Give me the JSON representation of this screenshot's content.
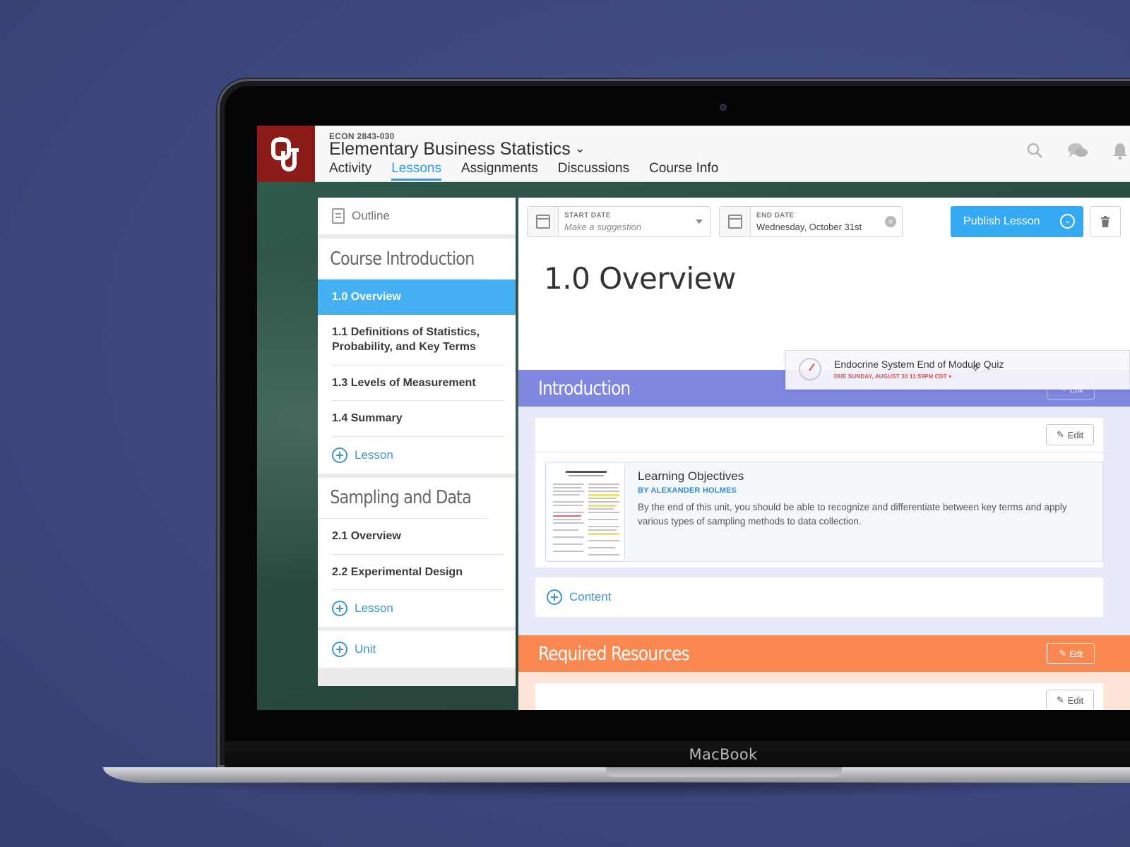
{
  "header": {
    "course_code": "ECON 2843-030",
    "course_title": "Elementary Business Statistics",
    "tabs": [
      {
        "label": "Activity",
        "active": false
      },
      {
        "label": "Lessons",
        "active": true
      },
      {
        "label": "Assignments",
        "active": false
      },
      {
        "label": "Discussions",
        "active": false
      },
      {
        "label": "Course Info",
        "active": false
      }
    ],
    "icons": [
      "search-icon",
      "chat-icon",
      "notification-bell-icon"
    ]
  },
  "sidebar": {
    "outline_label": "Outline",
    "units": [
      {
        "title": "Course Introduction",
        "lessons": [
          "1.0 Overview",
          "1.1 Definitions of Statistics, Probability, and Key Terms",
          "1.3 Levels of Measurement",
          "1.4 Summary"
        ],
        "active_index": 0,
        "add_label": "Lesson"
      },
      {
        "title": "Sampling and Data",
        "lessons": [
          "2.1 Overview",
          "2.2 Experimental Design"
        ],
        "add_label": "Lesson"
      }
    ],
    "add_unit_label": "Unit"
  },
  "main": {
    "start_date": {
      "label": "START DATE",
      "placeholder": "Make a suggestion"
    },
    "end_date": {
      "label": "END DATE",
      "value": "Wednesday, October 31st"
    },
    "publish_label": "Publish Lesson",
    "lesson_title": "1.0 Overview",
    "sections": {
      "introduction": "Introduction",
      "required": "Required Resources"
    },
    "edit_label": "Edit",
    "document": {
      "title": "Learning Objectives",
      "author": "BY ALEXANDER HOLMES",
      "description": "By the end of this unit, you should be able to recognize and differentiate between key terms and apply various types of sampling methods to data collection."
    },
    "add_content_label": "Content",
    "quiz": {
      "title": "Endocrine System End of Module Quiz",
      "due": "DUE SUNDAY, AUGUST 30 11:59PM CDT ▾"
    }
  },
  "device": {
    "brand_label": "MacBook"
  },
  "colors": {
    "background": "#3f4a82",
    "brand_red": "#8d1b17",
    "accent_blue": "#35a9f2",
    "active_lesson": "#45b1f2",
    "intro_band": "#8087e1",
    "required_band": "#fa8850"
  }
}
